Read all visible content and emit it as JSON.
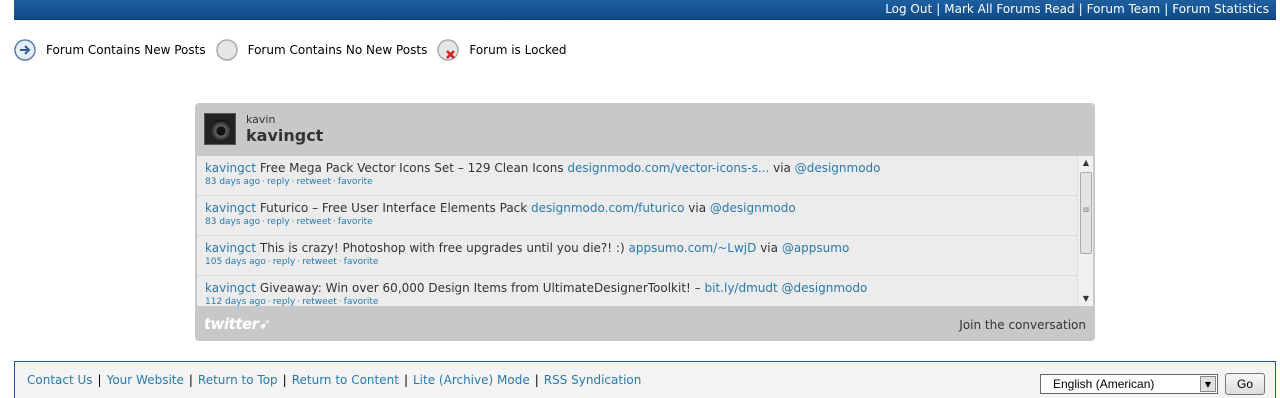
{
  "topbar": {
    "links": [
      "Log Out",
      "Mark All Forums Read",
      "Forum Team",
      "Forum Statistics"
    ],
    "separator": "|"
  },
  "legend": {
    "items": [
      {
        "label": "Forum Contains New Posts",
        "icon": "new-posts-icon"
      },
      {
        "label": "Forum Contains No New Posts",
        "icon": "no-new-posts-icon"
      },
      {
        "label": "Forum is Locked",
        "icon": "locked-icon"
      }
    ]
  },
  "twitter_widget": {
    "name": "kavin",
    "username": "kavingct",
    "tweets": [
      {
        "user": "kavingct",
        "text": "Free Mega Pack Vector Icons Set – 129 Clean Icons",
        "link": "designmodo.com/vector-icons-s...",
        "via_word": "via",
        "via": "@designmodo",
        "age": "83 days ago",
        "actions": [
          "reply",
          "retweet",
          "favorite"
        ]
      },
      {
        "user": "kavingct",
        "text": "Futurico – Free User Interface Elements Pack",
        "link": "designmodo.com/futurico",
        "via_word": "via",
        "via": "@designmodo",
        "age": "83 days ago",
        "actions": [
          "reply",
          "retweet",
          "favorite"
        ]
      },
      {
        "user": "kavingct",
        "text": "This is crazy! Photoshop with free upgrades until you die?! :)",
        "link": "appsumo.com/~LwjD",
        "via_word": "via",
        "via": "@appsumo",
        "age": "105 days ago",
        "actions": [
          "reply",
          "retweet",
          "favorite"
        ]
      },
      {
        "user": "kavingct",
        "text": "Giveaway: Win over 60,000 Design Items from UltimateDesignerToolkit! –",
        "link": "bit.ly/dmudt",
        "via_word": "",
        "via": "@designmodo",
        "age": "112 days ago",
        "actions": [
          "reply",
          "retweet",
          "favorite"
        ]
      }
    ],
    "logo_text": "twitter",
    "join_label": "Join the conversation"
  },
  "footer": {
    "links": [
      "Contact Us",
      "Your Website",
      "Return to Top",
      "Return to Content",
      "Lite (Archive) Mode",
      "RSS Syndication"
    ],
    "separator": "|",
    "language_value": "English (American)",
    "go_label": "Go"
  },
  "colors": {
    "topbar": "#1f5fa0",
    "link": "#2a7ab0",
    "widget_bg": "#c8c8c8"
  }
}
